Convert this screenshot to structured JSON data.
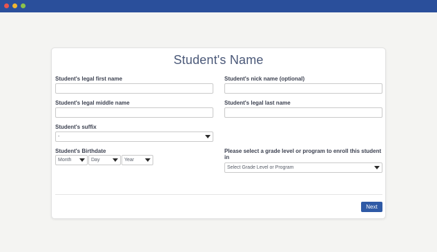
{
  "form": {
    "title": "Student's Name",
    "fields": {
      "first_name_label": "Student's legal first name",
      "nick_name_label": "Student's nick name (optional)",
      "middle_name_label": "Student's legal middle name",
      "last_name_label": "Student's legal last name",
      "suffix_label": "Student's suffix",
      "suffix_value": "-",
      "birthdate_label": "Student's Birthdate",
      "month_value": "Month",
      "day_value": "Day",
      "year_value": "Year",
      "grade_label": "Please select a grade level or program to enroll this student in",
      "grade_value": "Select Grade Level or Program"
    },
    "next_label": "Next"
  },
  "colors": {
    "titlebar": "#2a4f9b",
    "button": "#2f5aa6",
    "title_text": "#4a5878"
  },
  "icons": [
    "close-dot-icon",
    "minimize-dot-icon",
    "maximize-dot-icon",
    "caret-down-icon"
  ]
}
